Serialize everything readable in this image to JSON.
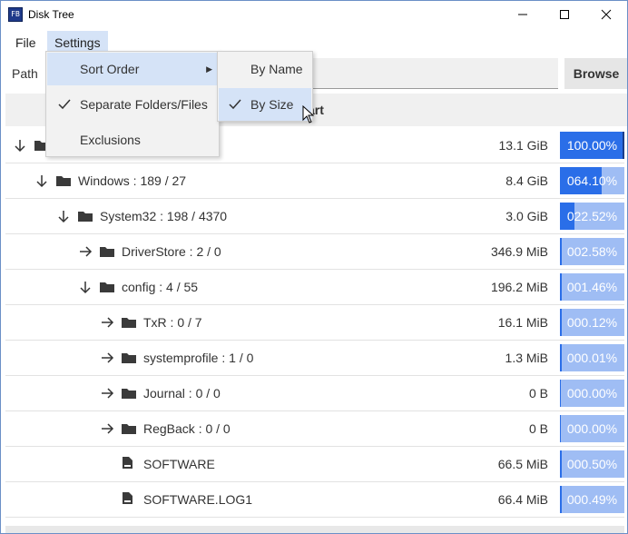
{
  "window": {
    "title": "Disk Tree",
    "app_icon_text": "FB",
    "border_color": "#6b8fc7"
  },
  "menubar": {
    "file": "File",
    "settings": "Settings"
  },
  "path": {
    "label": "Path",
    "value": "",
    "browse": "Browse"
  },
  "start_row": {
    "label": "art"
  },
  "settings_menu": {
    "items": [
      {
        "label": "Sort Order",
        "checked": false,
        "has_submenu": true
      },
      {
        "label": "Separate Folders/Files",
        "checked": true
      },
      {
        "label": "Exclusions",
        "checked": false
      }
    ]
  },
  "sort_submenu": {
    "items": [
      {
        "label": "By Name",
        "checked": false
      },
      {
        "label": "By Size",
        "checked": true
      }
    ]
  },
  "colors": {
    "accent": "#2a6ee8",
    "bar_bg": "#9fbdf4",
    "highlight": "#d5e3f7"
  },
  "tree": {
    "rows": [
      {
        "name": "",
        "size": "13.1 GiB",
        "percent": "100.00%",
        "fraction": 1.0,
        "kind": "folder",
        "expanded": true,
        "depth": 0
      },
      {
        "name": "Windows : 189 / 27",
        "size": "8.4 GiB",
        "percent": "064.10%",
        "fraction": 0.641,
        "kind": "folder",
        "expanded": true,
        "depth": 1
      },
      {
        "name": "System32 : 198 / 4370",
        "size": "3.0 GiB",
        "percent": "022.52%",
        "fraction": 0.2252,
        "kind": "folder",
        "expanded": true,
        "depth": 2
      },
      {
        "name": "DriverStore : 2 / 0",
        "size": "346.9 MiB",
        "percent": "002.58%",
        "fraction": 0.0258,
        "kind": "folder",
        "expanded": false,
        "depth": 3
      },
      {
        "name": "config : 4 / 55",
        "size": "196.2 MiB",
        "percent": "001.46%",
        "fraction": 0.0146,
        "kind": "folder",
        "expanded": true,
        "depth": 3
      },
      {
        "name": "TxR : 0 / 7",
        "size": "16.1 MiB",
        "percent": "000.12%",
        "fraction": 0.0012,
        "kind": "folder",
        "expanded": false,
        "depth": 4
      },
      {
        "name": "systemprofile : 1 / 0",
        "size": "1.3 MiB",
        "percent": "000.01%",
        "fraction": 0.0001,
        "kind": "folder",
        "expanded": false,
        "depth": 4
      },
      {
        "name": "Journal : 0 / 0",
        "size": "0 B",
        "percent": "000.00%",
        "fraction": 0.0,
        "kind": "folder",
        "expanded": false,
        "depth": 4
      },
      {
        "name": "RegBack : 0 / 0",
        "size": "0 B",
        "percent": "000.00%",
        "fraction": 0.0,
        "kind": "folder",
        "expanded": false,
        "depth": 4
      },
      {
        "name": "SOFTWARE",
        "size": "66.5 MiB",
        "percent": "000.50%",
        "fraction": 0.005,
        "kind": "file",
        "depth": 4
      },
      {
        "name": "SOFTWARE.LOG1",
        "size": "66.4 MiB",
        "percent": "000.49%",
        "fraction": 0.0049,
        "kind": "file",
        "depth": 4
      }
    ]
  }
}
